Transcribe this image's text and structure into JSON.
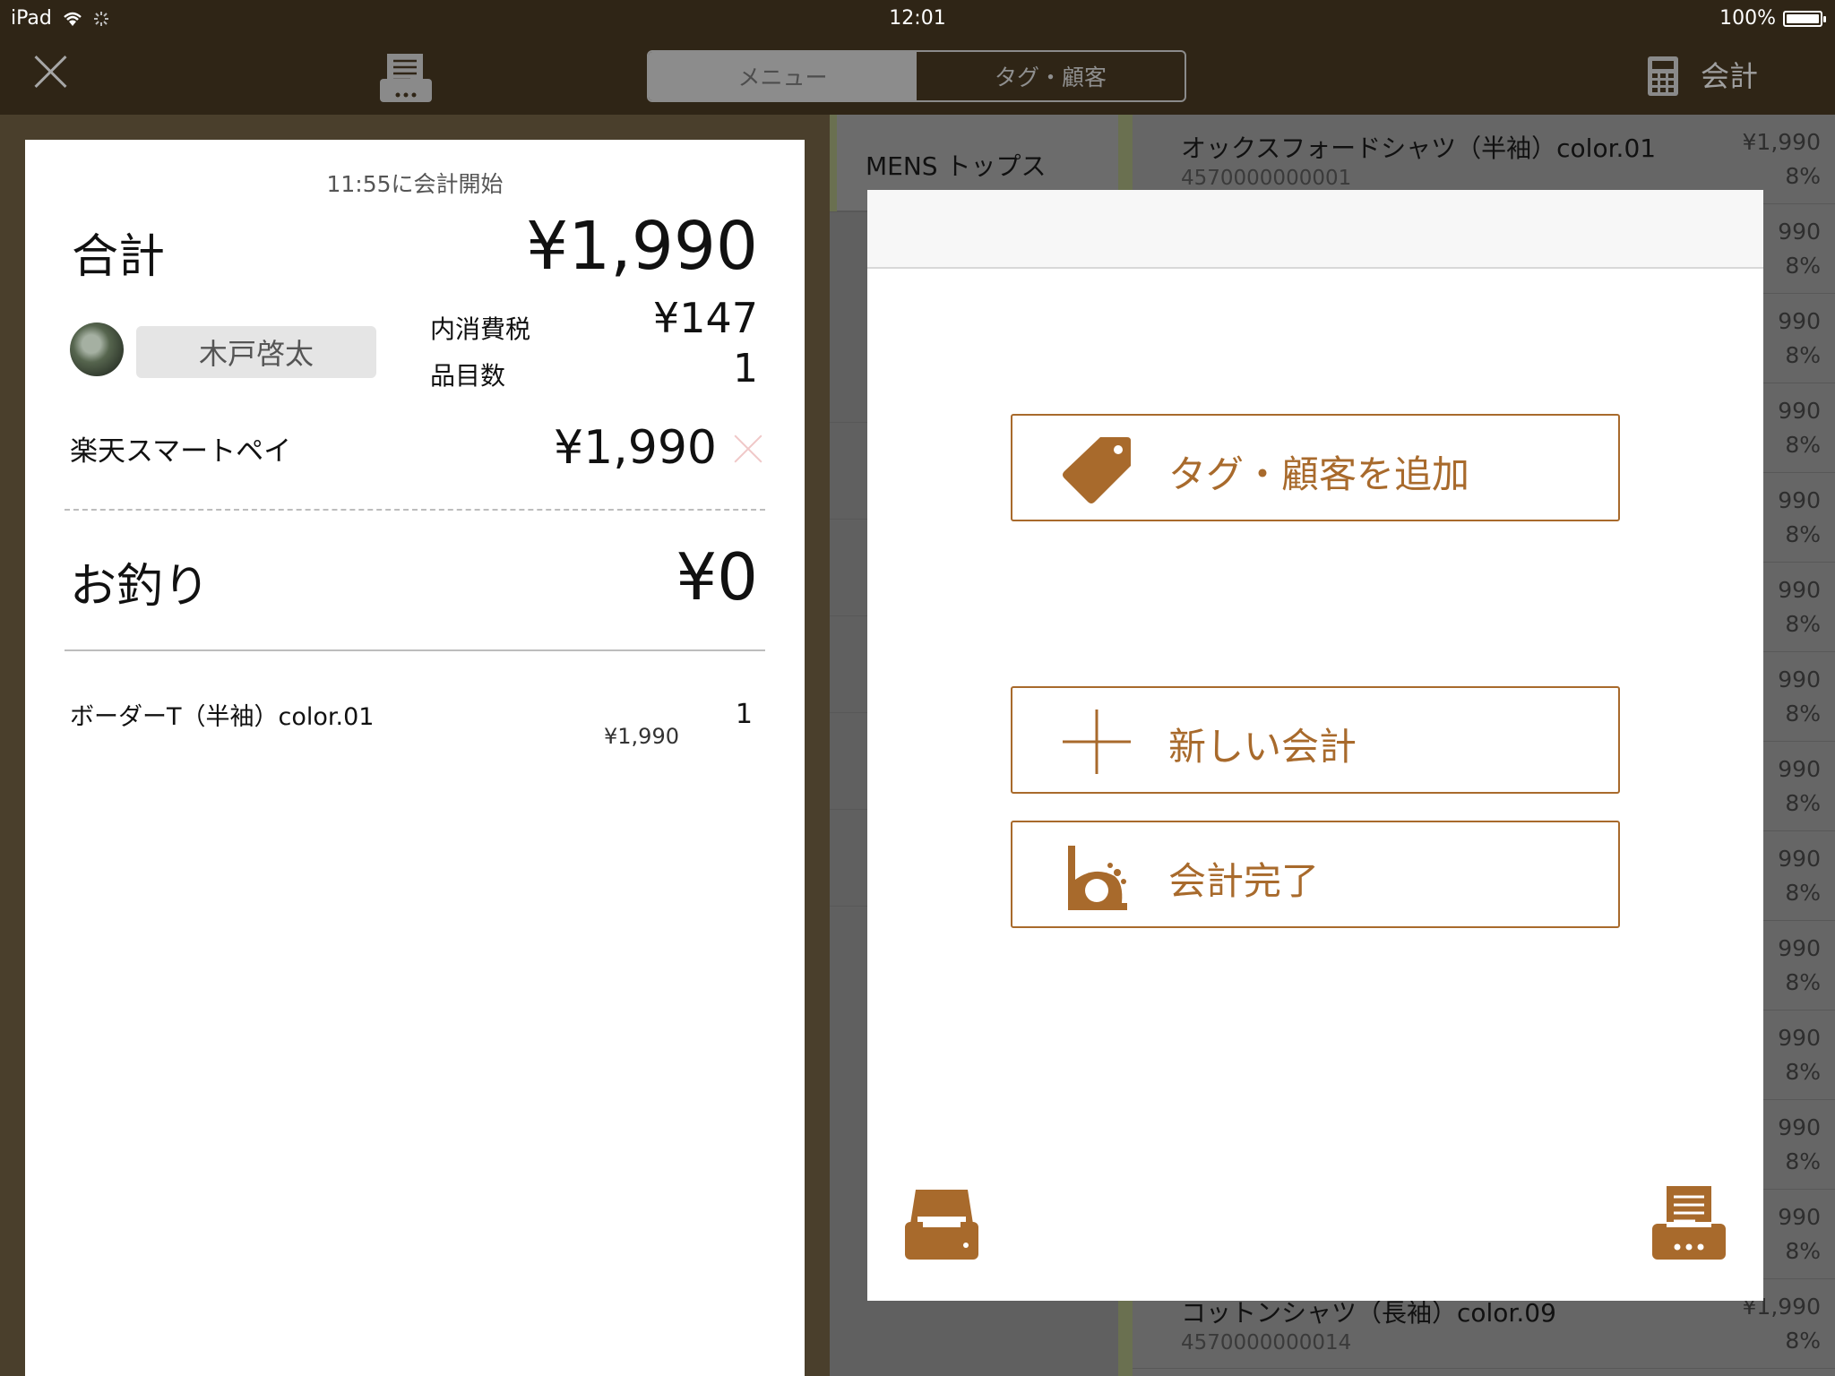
{
  "status_bar": {
    "device": "iPad",
    "time": "12:01",
    "battery": "100%",
    "battery_level": 1.0
  },
  "toolbar": {
    "tabs": [
      {
        "label": "メニュー",
        "active": true
      },
      {
        "label": "タグ・顧客",
        "active": false
      }
    ],
    "checkout_label": "会計"
  },
  "bill": {
    "started_at": "11:55に会計開始",
    "total_label": "合計",
    "total_value": "¥1,990",
    "customer_name": "木戸啓太",
    "tax_label": "内消費税",
    "tax_value": "¥147",
    "item_count_label": "品目数",
    "item_count_value": "1",
    "payment_method": "楽天スマートペイ",
    "payment_amount": "¥1,990",
    "change_label": "お釣り",
    "change_value": "¥0",
    "lines": [
      {
        "name": "ボーダーT（半袖）color.01",
        "price": "¥1,990",
        "qty": "1"
      }
    ]
  },
  "menu": {
    "category": "MENS トップス",
    "first_product": {
      "name": "オックスフォードシャツ（半袖）color.01",
      "code": "4570000000001",
      "price": "¥1,990",
      "tax": "8%"
    },
    "last_product": {
      "name": "コットンシャツ（長袖）color.09",
      "code": "4570000000014",
      "price": "¥1,990",
      "tax": "8%"
    },
    "partial_price": "990",
    "partial_tax": "8%"
  },
  "modal": {
    "add_tag_customer": "タグ・顧客を追加",
    "new_checkout": "新しい会計",
    "finish_checkout": "会計完了"
  },
  "colors": {
    "accent": "#a86a2c",
    "topbar": "#2f2516",
    "frame": "#4a3f2c"
  },
  "icons": [
    "close-icon",
    "receipt-icon",
    "calculator-icon",
    "tag-icon",
    "plus-icon",
    "bell-icon",
    "cash-drawer-icon",
    "printer-icon"
  ]
}
